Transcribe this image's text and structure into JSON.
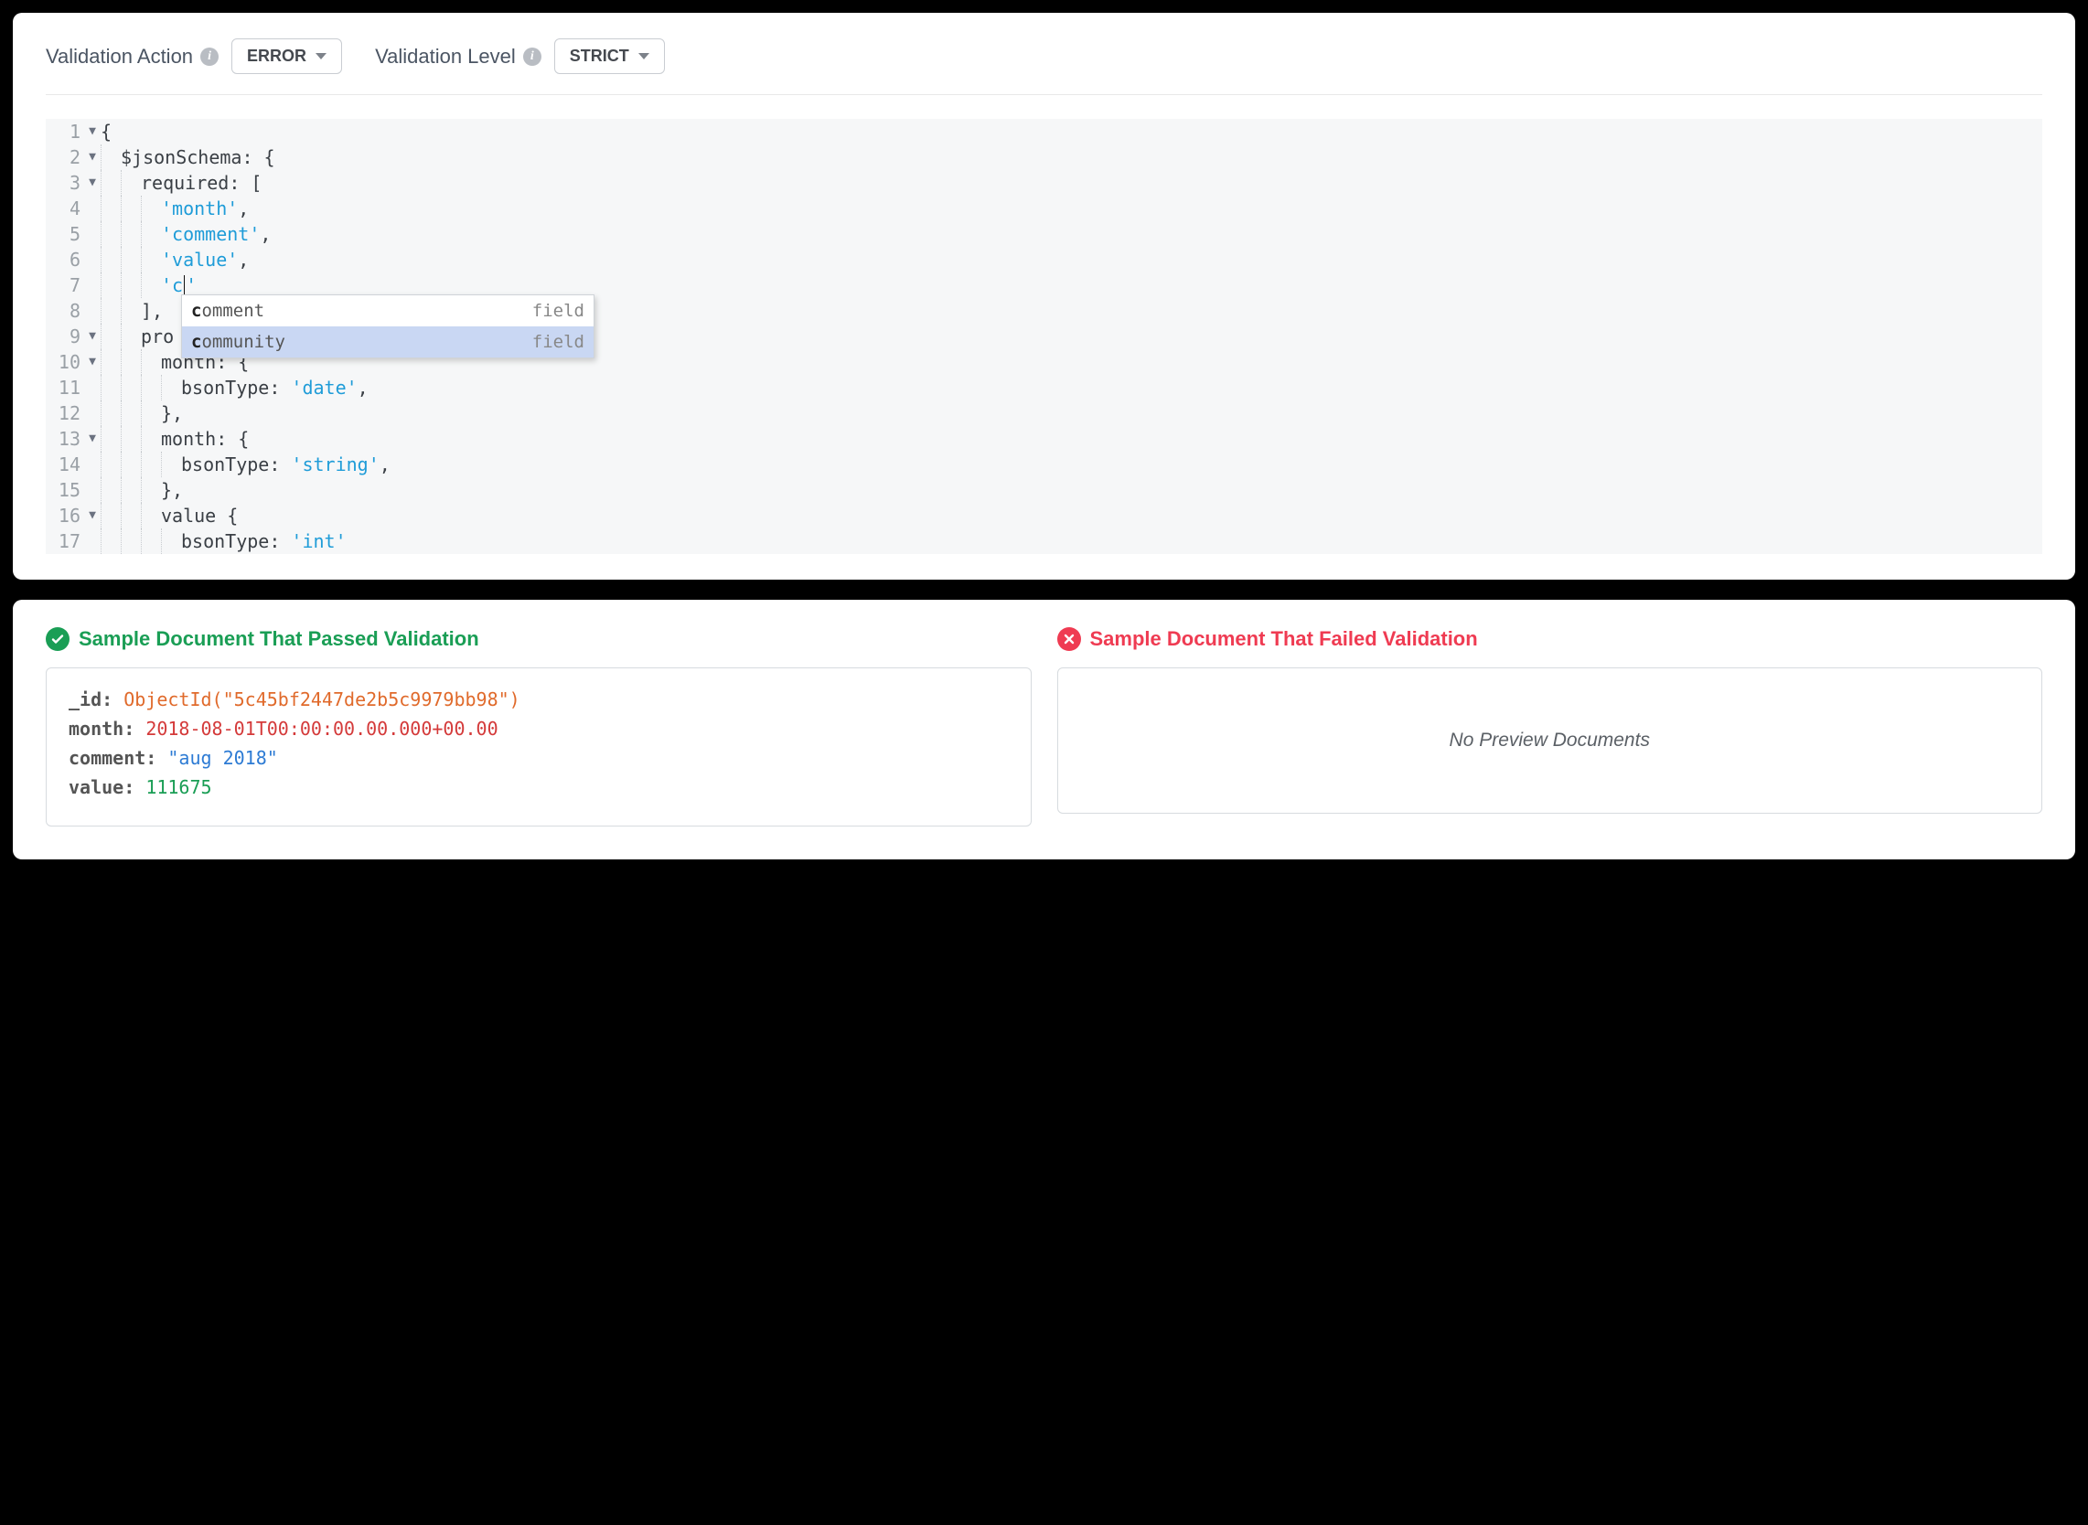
{
  "toolbar": {
    "action_label": "Validation Action",
    "action_value": "ERROR",
    "level_label": "Validation Level",
    "level_value": "STRICT"
  },
  "editor": {
    "lines": [
      {
        "n": 1,
        "fold": true,
        "indent": 0,
        "pre": "{",
        "str": "",
        "post": ""
      },
      {
        "n": 2,
        "fold": true,
        "indent": 1,
        "pre": "$jsonSchema: {",
        "str": "",
        "post": ""
      },
      {
        "n": 3,
        "fold": true,
        "indent": 2,
        "pre": "required: [",
        "str": "",
        "post": ""
      },
      {
        "n": 4,
        "fold": false,
        "indent": 3,
        "pre": "",
        "str": "'month'",
        "post": ","
      },
      {
        "n": 5,
        "fold": false,
        "indent": 3,
        "pre": "",
        "str": "'comment'",
        "post": ","
      },
      {
        "n": 6,
        "fold": false,
        "indent": 3,
        "pre": "",
        "str": "'value'",
        "post": ","
      },
      {
        "n": 7,
        "fold": false,
        "indent": 3,
        "pre": "",
        "str": "'c'",
        "post": "",
        "cursor": true
      },
      {
        "n": 8,
        "fold": false,
        "indent": 2,
        "pre": "],",
        "str": "",
        "post": ""
      },
      {
        "n": 9,
        "fold": true,
        "indent": 2,
        "pre": "pro",
        "str": "",
        "post": "",
        "truncated": true
      },
      {
        "n": 10,
        "fold": true,
        "indent": 3,
        "pre": "month: {",
        "str": "",
        "post": ""
      },
      {
        "n": 11,
        "fold": false,
        "indent": 4,
        "pre": "bsonType: ",
        "str": "'date'",
        "post": ","
      },
      {
        "n": 12,
        "fold": false,
        "indent": 3,
        "pre": "},",
        "str": "",
        "post": ""
      },
      {
        "n": 13,
        "fold": true,
        "indent": 3,
        "pre": "month: {",
        "str": "",
        "post": ""
      },
      {
        "n": 14,
        "fold": false,
        "indent": 4,
        "pre": "bsonType: ",
        "str": "'string'",
        "post": ","
      },
      {
        "n": 15,
        "fold": false,
        "indent": 3,
        "pre": "},",
        "str": "",
        "post": ""
      },
      {
        "n": 16,
        "fold": true,
        "indent": 3,
        "pre": "value {",
        "str": "",
        "post": ""
      },
      {
        "n": 17,
        "fold": false,
        "indent": 4,
        "pre": "bsonType: ",
        "str": "'int'",
        "post": ""
      }
    ]
  },
  "autocomplete": {
    "items": [
      {
        "match": "c",
        "rest": "omment",
        "type": "field",
        "selected": false
      },
      {
        "match": "c",
        "rest": "ommunity",
        "type": "field",
        "selected": true
      }
    ]
  },
  "results": {
    "pass_title": "Sample Document That Passed Validation",
    "fail_title": "Sample Document That Failed Validation",
    "no_preview": "No Preview Documents",
    "passed_doc": {
      "id_key": "_id",
      "id_prefix": "ObjectId(\"",
      "id_value": "5c45bf2447de2b5c9979bb98",
      "id_suffix": "\")",
      "month_key": "month",
      "month_value": "2018-08-01T00:00:00.00.000+00.00",
      "comment_key": "comment",
      "comment_value": "\"aug 2018\"",
      "value_key": "value",
      "value_value": "111675"
    }
  }
}
